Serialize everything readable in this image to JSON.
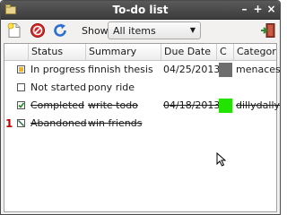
{
  "window": {
    "title": "To-do list"
  },
  "toolbar": {
    "new_icon": "new-document-icon",
    "delete_icon": "delete-icon",
    "refresh_icon": "refresh-icon",
    "show_label": "Show:",
    "show_value": "All items",
    "exit_icon": "exit-door-icon"
  },
  "columns": {
    "status": "Status",
    "summary": "Summary",
    "due": "Due Date",
    "color": "C",
    "category": "Category"
  },
  "rows": [
    {
      "status": "In progress",
      "summary": "finnish thesis",
      "due": "04/25/2013",
      "color": "#6e6e6e",
      "category": "menaces",
      "done": false,
      "priority": ""
    },
    {
      "status": "Not started",
      "summary": "pony ride",
      "due": "",
      "color": "",
      "category": "",
      "done": false,
      "priority": ""
    },
    {
      "status": "Completed",
      "summary": "write todo",
      "due": "04/18/2013",
      "color": "#22e400",
      "category": "dillydally",
      "done": true,
      "priority": ""
    },
    {
      "status": "Abandoned",
      "summary": "win friends",
      "due": "",
      "color": "",
      "category": "",
      "done": true,
      "priority": "1"
    }
  ]
}
